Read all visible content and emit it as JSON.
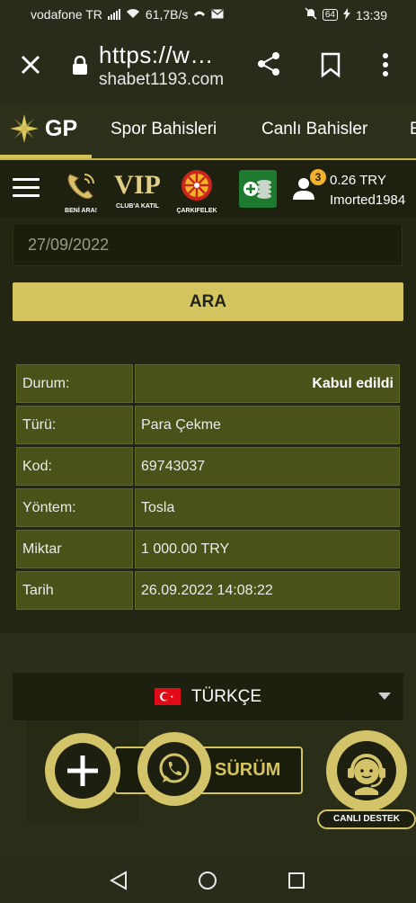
{
  "status": {
    "carrier": "vodafone TR",
    "speed": "61,7B/s",
    "battery": "64",
    "time": "13:39"
  },
  "browser": {
    "url_line1": "https://w…",
    "url_line2": "shabet1193.com",
    "icons": [
      "close-icon",
      "lock-icon",
      "share-icon",
      "bookmark-icon",
      "more-vert-icon"
    ]
  },
  "nav": {
    "logo": "GP",
    "items": [
      "Spor Bahisleri",
      "Canlı Bahisler",
      "E"
    ]
  },
  "toolbar": {
    "items": [
      {
        "label": "BENİ ARA!",
        "icon": "phone-icon"
      },
      {
        "label": "CLUB'A KATIL",
        "icon": "vip-icon",
        "title": "VIP"
      },
      {
        "label": "ÇARKIFELEK",
        "icon": "wheel-icon"
      }
    ],
    "notification_count": "3",
    "balance": "0.26 TRY",
    "username": "Imorted1984"
  },
  "filter": {
    "date_value": "27/09/2022",
    "search_label": "ARA"
  },
  "details": [
    {
      "label": "Durum:",
      "value": "Kabul edildi"
    },
    {
      "label": "Türü:",
      "value": "Para Çekme"
    },
    {
      "label": "Kod:",
      "value": "69743037"
    },
    {
      "label": "Yöntem:",
      "value": "Tosla"
    },
    {
      "label": "Miktar",
      "value": "1 000.00 TRY"
    },
    {
      "label": "Tarih",
      "value": "26.09.2022 14:08:22"
    }
  ],
  "footer": {
    "language": "TÜRKÇE",
    "version_label": "SÜRÜM",
    "live_support_label": "CANLI DESTEK"
  },
  "colors": {
    "accent": "#d3c460",
    "table_cell": "#4a5219",
    "background": "#232612"
  }
}
